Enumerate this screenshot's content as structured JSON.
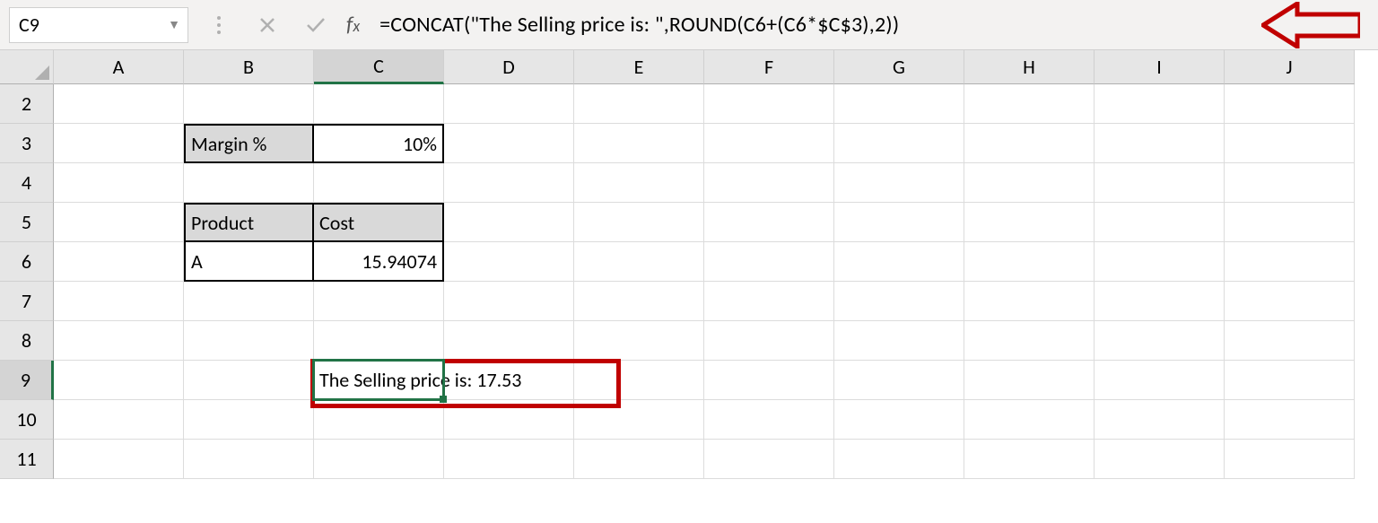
{
  "formula_bar": {
    "cell_ref": "C9",
    "formula": "=CONCAT(\"The Selling price is: \",ROUND(C6+(C6*$C$3),2))"
  },
  "columns": [
    "A",
    "B",
    "C",
    "D",
    "E",
    "F",
    "G",
    "H",
    "I",
    "J"
  ],
  "rows": [
    "2",
    "3",
    "4",
    "5",
    "6",
    "7",
    "8",
    "9",
    "10",
    "11"
  ],
  "cells": {
    "B3": "Margin %",
    "C3": "10%",
    "B5": "Product",
    "C5": "Cost",
    "B6": "A",
    "C6": "15.94074",
    "C9": "The Selling price is: 17.53"
  },
  "active_cell": "C9"
}
